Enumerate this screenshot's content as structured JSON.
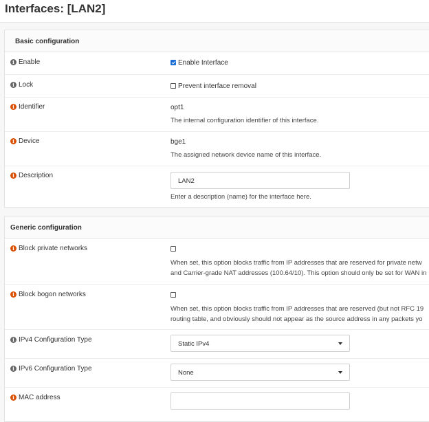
{
  "page": {
    "title": "Interfaces: [LAN2]"
  },
  "basic": {
    "heading": "Basic configuration",
    "enable": {
      "label": "Enable",
      "checkbox_label": "Enable Interface",
      "checked": true
    },
    "lock": {
      "label": "Lock",
      "checkbox_label": "Prevent interface removal",
      "checked": false
    },
    "identifier": {
      "label": "Identifier",
      "value": "opt1",
      "help": "The internal configuration identifier of this interface."
    },
    "device": {
      "label": "Device",
      "value": "bge1",
      "help": "The assigned network device name of this interface."
    },
    "description": {
      "label": "Description",
      "value": "LAN2",
      "help": "Enter a description (name) for the interface here."
    }
  },
  "generic": {
    "heading": "Generic configuration",
    "block_private": {
      "label": "Block private networks",
      "help1": "When set, this option blocks traffic from IP addresses that are reserved for private netw",
      "help2": "and Carrier-grade NAT addresses (100.64/10). This option should only be set for WAN in"
    },
    "block_bogon": {
      "label": "Block bogon networks",
      "help1": "When set, this option blocks traffic from IP addresses that are reserved (but not RFC 19",
      "help2": "routing table, and obviously should not appear as the source address in any packets yo"
    },
    "ipv4_type": {
      "label": "IPv4 Configuration Type",
      "selected": "Static IPv4"
    },
    "ipv6_type": {
      "label": "IPv6 Configuration Type",
      "selected": "None"
    },
    "mac": {
      "label": "MAC address",
      "value": ""
    }
  },
  "icons": {
    "info": "info-icon",
    "info_color_gray": "#666666",
    "info_color_orange": "#d94f00",
    "checkbox_accent": "#1a6fd6"
  }
}
